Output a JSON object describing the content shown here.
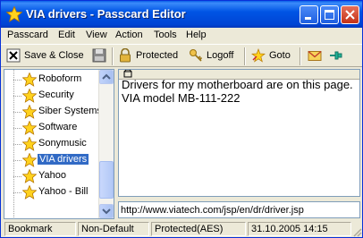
{
  "window": {
    "title": "VIA drivers - Passcard Editor"
  },
  "menubar": {
    "items": [
      "Passcard",
      "Edit",
      "View",
      "Action",
      "Tools",
      "Help"
    ]
  },
  "toolbar": {
    "save_close_label": "Save & Close",
    "protected_label": "Protected",
    "logoff_label": "Logoff",
    "goto_label": "Goto"
  },
  "tree": {
    "items": [
      "Roboform",
      "Security",
      "Siber Systems",
      "Software",
      "Sonymusic",
      "VIA drivers",
      "Yahoo",
      "Yahoo - Bill"
    ],
    "selected": "VIA drivers"
  },
  "note": {
    "text": "Drivers for my motherboard are on this page.\nVIA model MB-111-222"
  },
  "url": {
    "value": "http://www.viatech.com/jsp/en/dr/driver.jsp"
  },
  "statusbar": {
    "panel1": "Bookmark",
    "panel2": "Non-Default",
    "panel3": "Protected(AES)",
    "panel4": "31.10.2005 14:15"
  },
  "colors": {
    "title_bar": "#0055e5",
    "selection": "#316ac5",
    "window_bg": "#ece9d8"
  }
}
